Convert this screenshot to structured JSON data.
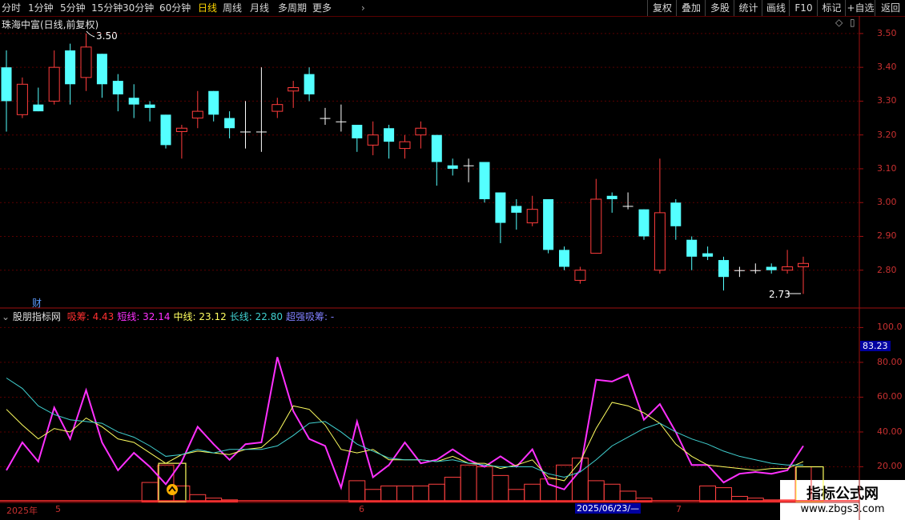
{
  "toolbar": {
    "periods": [
      "分时",
      "1分钟",
      "5分钟",
      "15分钟",
      "30分钟",
      "60分钟",
      "日线",
      "周线",
      "月线",
      "多周期",
      "更多"
    ],
    "active_period": "日线",
    "right_buttons": [
      "复权",
      "叠加",
      "多股",
      "统计",
      "画线",
      "F10",
      "标记",
      "+自选",
      "返回"
    ]
  },
  "main_chart": {
    "title": "珠海中富(日线,前复权)",
    "high_label": "3.50",
    "low_label": "2.73",
    "cai_label": "财",
    "price_axis": [
      "3.50",
      "3.40",
      "3.30",
      "3.20",
      "3.10",
      "3.00",
      "2.90",
      "2.80"
    ]
  },
  "indicator": {
    "name": "股朋指标网",
    "items": [
      {
        "label": "吸筹:",
        "value": "4.43",
        "color": "#ff3030"
      },
      {
        "label": "短线:",
        "value": "32.14",
        "color": "#ff30ff"
      },
      {
        "label": "中线:",
        "value": "23.12",
        "color": "#ffff60"
      },
      {
        "label": "长线:",
        "value": "22.80",
        "color": "#40d0d0"
      },
      {
        "label": "超强吸筹:",
        "value": "-",
        "color": "#8080ff"
      }
    ],
    "axis": [
      "100.0",
      "80.00",
      "60.00",
      "40.00",
      "20.00"
    ],
    "current_value": "83.23"
  },
  "date_axis": {
    "labels": [
      "2025年",
      "5",
      "6",
      "7"
    ],
    "cursor_date": "2025/06/23/—"
  },
  "watermark": {
    "title": "指标公式网",
    "url": "www.zbgs3.com"
  },
  "colors": {
    "up": "#ff3c3c",
    "down": "#54ffff",
    "grid": "#5a0000",
    "accent": "#ffd700"
  },
  "chart_data": {
    "type": "candlestick",
    "ylim": [
      2.7,
      3.54
    ],
    "candles": [
      [
        3.4,
        3.3,
        3.45,
        3.21
      ],
      [
        3.26,
        3.35,
        3.37,
        3.25
      ],
      [
        3.29,
        3.27,
        3.34,
        3.27
      ],
      [
        3.3,
        3.4,
        3.45,
        3.29
      ],
      [
        3.45,
        3.35,
        3.47,
        3.29
      ],
      [
        3.37,
        3.46,
        3.5,
        3.33
      ],
      [
        3.44,
        3.35,
        3.44,
        3.31
      ],
      [
        3.36,
        3.32,
        3.38,
        3.27
      ],
      [
        3.31,
        3.29,
        3.35,
        3.25
      ],
      [
        3.29,
        3.28,
        3.3,
        3.24
      ],
      [
        3.26,
        3.17,
        3.26,
        3.16
      ],
      [
        3.21,
        3.22,
        3.23,
        3.13
      ],
      [
        3.25,
        3.27,
        3.33,
        3.22
      ],
      [
        3.33,
        3.26,
        3.33,
        3.24
      ],
      [
        3.25,
        3.22,
        3.27,
        3.19
      ],
      [
        3.21,
        3.21,
        3.3,
        3.16
      ],
      [
        3.21,
        3.21,
        3.4,
        3.15
      ],
      [
        3.27,
        3.29,
        3.31,
        3.25
      ],
      [
        3.33,
        3.34,
        3.36,
        3.28
      ],
      [
        3.38,
        3.32,
        3.4,
        3.3
      ],
      [
        3.25,
        3.25,
        3.28,
        3.23
      ],
      [
        3.24,
        3.24,
        3.29,
        3.21
      ],
      [
        3.23,
        3.19,
        3.23,
        3.15
      ],
      [
        3.17,
        3.2,
        3.24,
        3.14
      ],
      [
        3.22,
        3.18,
        3.23,
        3.13
      ],
      [
        3.16,
        3.18,
        3.2,
        3.13
      ],
      [
        3.2,
        3.22,
        3.24,
        3.16
      ],
      [
        3.2,
        3.12,
        3.2,
        3.05
      ],
      [
        3.11,
        3.1,
        3.13,
        3.08
      ],
      [
        3.11,
        3.11,
        3.13,
        3.06
      ],
      [
        3.12,
        3.01,
        3.12,
        3.0
      ],
      [
        3.03,
        2.94,
        3.03,
        2.88
      ],
      [
        2.99,
        2.97,
        3.01,
        2.92
      ],
      [
        2.94,
        2.98,
        3.02,
        2.93
      ],
      [
        3.01,
        2.86,
        3.01,
        2.85
      ],
      [
        2.86,
        2.81,
        2.87,
        2.8
      ],
      [
        2.77,
        2.8,
        2.81,
        2.76
      ],
      [
        2.85,
        3.01,
        3.07,
        2.85
      ],
      [
        3.02,
        3.01,
        3.03,
        2.97
      ],
      [
        2.99,
        2.99,
        3.03,
        2.98
      ],
      [
        2.98,
        2.9,
        2.98,
        2.89
      ],
      [
        2.8,
        2.97,
        3.13,
        2.79
      ],
      [
        3.0,
        2.93,
        3.01,
        2.89
      ],
      [
        2.89,
        2.84,
        2.9,
        2.8
      ],
      [
        2.85,
        2.84,
        2.87,
        2.83
      ],
      [
        2.83,
        2.78,
        2.84,
        2.74
      ],
      [
        2.8,
        2.8,
        2.81,
        2.78
      ],
      [
        2.8,
        2.8,
        2.82,
        2.79
      ],
      [
        2.81,
        2.8,
        2.82,
        2.79
      ],
      [
        2.8,
        2.81,
        2.86,
        2.79
      ],
      [
        2.81,
        2.82,
        2.84,
        2.73
      ]
    ],
    "indicator_ylim": [
      0,
      108
    ],
    "series": [
      {
        "name": "短线",
        "color": "#ff30ff",
        "values": [
          18,
          34,
          23,
          54,
          36,
          64,
          34,
          18,
          28,
          20,
          10,
          23,
          43,
          33,
          24,
          33,
          34,
          83,
          52,
          36,
          32,
          8,
          46,
          14,
          21,
          34,
          22,
          24,
          30,
          24,
          20,
          26,
          20,
          30,
          10,
          7,
          18,
          70,
          69,
          73,
          47,
          56,
          40,
          21,
          21,
          11,
          16,
          17,
          16,
          18,
          32
        ]
      },
      {
        "name": "中线",
        "color": "#ffff60",
        "values": [
          53,
          44,
          36,
          42,
          40,
          48,
          43,
          36,
          34,
          28,
          22,
          27,
          29,
          28,
          27,
          30,
          31,
          39,
          55,
          53,
          44,
          30,
          28,
          30,
          24,
          24,
          24,
          23,
          26,
          22,
          22,
          19,
          21,
          24,
          14,
          12,
          23,
          42,
          57,
          55,
          51,
          45,
          33,
          26,
          21,
          20,
          19,
          18,
          19,
          19,
          23
        ]
      },
      {
        "name": "长线",
        "color": "#40d0d0",
        "values": [
          71,
          65,
          55,
          50,
          47,
          46,
          45,
          40,
          37,
          32,
          26,
          27,
          30,
          28,
          30,
          30,
          30,
          32,
          38,
          45,
          46,
          40,
          33,
          29,
          25,
          24,
          24,
          23,
          24,
          22,
          21,
          20,
          20,
          20,
          16,
          14,
          17,
          24,
          32,
          37,
          42,
          45,
          40,
          36,
          33,
          29,
          26,
          24,
          22,
          21,
          21
        ]
      },
      {
        "name": "吸筹",
        "color": "#ff3030",
        "values": [
          0,
          0,
          0,
          0,
          0,
          0,
          0,
          0,
          0,
          11,
          21,
          9,
          4,
          2,
          1,
          0,
          0,
          0,
          0,
          0,
          0,
          0,
          12,
          7,
          9,
          9,
          9,
          10,
          14,
          21,
          20,
          15,
          7,
          10,
          13,
          21,
          25,
          12,
          10,
          6,
          2,
          0,
          0,
          0,
          9,
          8,
          3,
          2,
          1,
          1,
          20
        ]
      }
    ]
  }
}
